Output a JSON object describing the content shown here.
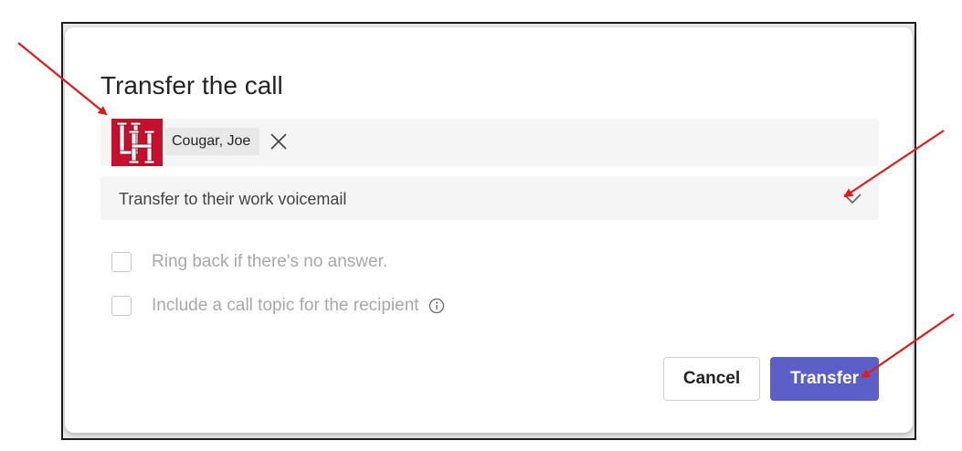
{
  "dialog": {
    "title": "Transfer the call",
    "recipient": {
      "name": "Cougar, Joe",
      "avatar_logo": "UH",
      "avatar_color": "#c8102e",
      "remove_icon": "close-icon"
    },
    "transfer_option": {
      "selected": "Transfer to their work voicemail",
      "icon": "chevron-down-icon"
    },
    "options": [
      {
        "label": "Ring back if there's no answer.",
        "checked": false,
        "enabled": false
      },
      {
        "label": "Include a call topic for the recipient",
        "checked": false,
        "enabled": false,
        "icon": "info-icon"
      }
    ],
    "buttons": {
      "cancel": "Cancel",
      "transfer": "Transfer"
    }
  },
  "colors": {
    "accent": "#5b5fc7",
    "annotation_arrows": "#e01b1b"
  }
}
